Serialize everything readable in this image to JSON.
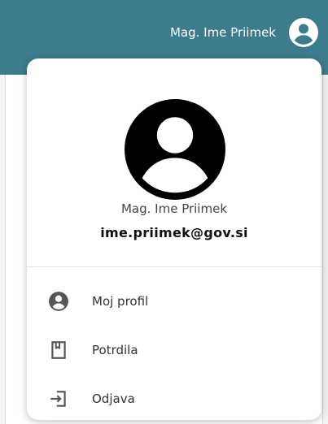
{
  "colors": {
    "header_bg": "#3d7c8c",
    "text_primary": "#111111",
    "text_secondary": "#444444",
    "icon": "#555555"
  },
  "header": {
    "user_name": "Mag. Ime Priimek",
    "avatar_icon": "account-circle-icon"
  },
  "profile": {
    "avatar_icon": "account-circle-icon",
    "name": "Mag. Ime Priimek",
    "email": "ime.priimek@gov.si"
  },
  "menu": {
    "items": [
      {
        "label": "Moj profil",
        "icon": "account-circle-icon"
      },
      {
        "label": "Potrdila",
        "icon": "certificate-book-icon"
      },
      {
        "label": "Odjava",
        "icon": "logout-icon"
      }
    ]
  }
}
